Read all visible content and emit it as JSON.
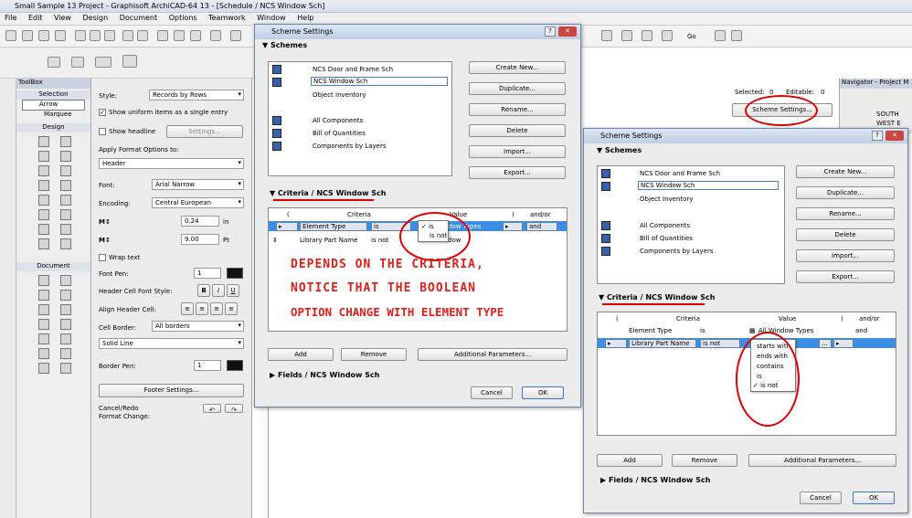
{
  "window_title": "Small Sample 13 Project - Graphisoft ArchiCAD-64 13 - [Schedule / NCS Window Sch]",
  "menu": [
    "File",
    "Edit",
    "View",
    "Design",
    "Document",
    "Options",
    "Teamwork",
    "Window",
    "Help"
  ],
  "toolbar": {
    "go_label": "Go"
  },
  "toolbox": {
    "title": "ToolBox",
    "selection_section": "Selection",
    "arrow": "Arrow",
    "marquee": "Marquee",
    "design_section": "Design",
    "document_section": "Document"
  },
  "settings": {
    "style_label": "Style:",
    "style_value": "Records by Rows",
    "show_uniform": "Show uniform items as a single entry",
    "show_headline": "Show headline",
    "settings_btn": "Settings...",
    "apply_format_label": "Apply Format Options to:",
    "apply_format_value": "Header",
    "font_label": "Font:",
    "font_value": "Arial Narrow",
    "encoding_label": "Encoding:",
    "encoding_value": "Central European",
    "size1_value": "0.24",
    "size1_unit": "in",
    "size2_value": "9.00",
    "size2_unit": "Pt",
    "wrap_text": "Wrap text",
    "font_pen_label": "Font Pen:",
    "font_pen_value": "1",
    "header_cell_font_label": "Header Cell Font Style:",
    "bold": "B",
    "italic": "I",
    "underline": "U",
    "align_header_label": "Align Header Cell:",
    "cell_border_label": "Cell Border:",
    "cell_border_value": "All borders",
    "line_type_value": "Solid Line",
    "border_pen_label": "Border Pen:",
    "border_pen_value": "1",
    "footer_btn": "Footer Settings...",
    "cancel_redo": "Cancel/Redo",
    "format_change": "Format Change:"
  },
  "info": {
    "selected_label": "Selected:",
    "selected_value": "0",
    "editable_label": "Editable:",
    "editable_value": "0",
    "scheme_btn": "Scheme Settings..."
  },
  "navigator": {
    "title": "Navigator - Project M",
    "item1": "SOUTH",
    "item2": "WEST E"
  },
  "dialog1": {
    "title": "Scheme Settings",
    "schemes_header": "Schemes",
    "schemes": [
      "NCS Door and Frame Sch",
      "NCS Window Sch",
      "Object Inventory",
      "All Components",
      "Bill of Quantities",
      "Components by Layers"
    ],
    "buttons": [
      "Create New...",
      "Duplicate...",
      "Rename...",
      "Delete",
      "Import...",
      "Export..."
    ],
    "criteria_header": "Criteria / NCS Window Sch",
    "col_open": "(",
    "col_criteria": "Criteria",
    "col_value": "Value",
    "col_close": ")",
    "col_andor": "and/or",
    "row1_criteria": "Element Type",
    "row1_op": "is",
    "row1_value": "dow Types",
    "row1_andor": "and",
    "row2_criteria": "Library Part Name",
    "row2_op": "is not",
    "row2_value": "dow",
    "popup": [
      "✓ is",
      "is not"
    ],
    "add": "Add",
    "remove": "Remove",
    "additional": "Additional Parameters...",
    "fields_header": "Fields / NCS Window Sch",
    "cancel": "Cancel",
    "ok": "OK"
  },
  "dialog2": {
    "title": "Scheme Settings",
    "schemes_header": "Schemes",
    "schemes": [
      "NCS Door and Frame Sch",
      "NCS Window Sch",
      "Object Inventory",
      "All Components",
      "Bill of Quantities",
      "Components by Layers"
    ],
    "buttons": [
      "Create New...",
      "Duplicate...",
      "Rename...",
      "Delete",
      "Import...",
      "Export..."
    ],
    "criteria_header": "Criteria / NCS Window Sch",
    "col_open": "(",
    "col_criteria": "Criteria",
    "col_value": "Value",
    "col_close": ")",
    "col_andor": "and/or",
    "row1_criteria": "Element Type",
    "row1_op": "is",
    "row1_value": "All Window Types",
    "row1_andor": "and",
    "row2_criteria": "Library Part Name",
    "row2_op": "is not",
    "row2_more": "...",
    "popup": [
      "starts with",
      "ends with",
      "contains",
      "is",
      "✓ is not"
    ],
    "add": "Add",
    "remove": "Remove",
    "additional": "Additional Parameters...",
    "fields_header": "Fields / NCS Window Sch",
    "cancel": "Cancel",
    "ok": "OK"
  },
  "annotation": {
    "line1": "DEPENDS ON THE CRITERIA,",
    "line2": "NOTICE THAT THE BOOLEAN",
    "line3": "OPTION CHANGE WITH ELEMENT TYPE"
  }
}
